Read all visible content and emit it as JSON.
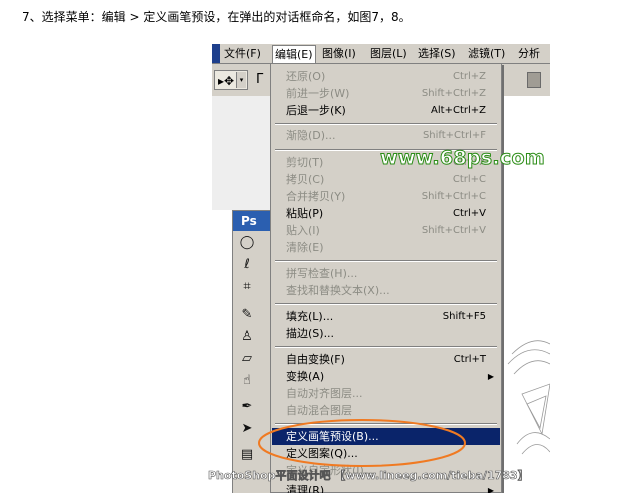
{
  "instruction": "7、选择菜单：编辑 > 定义画笔预设，在弹出的对话框命名，如图7，8。",
  "menubar": {
    "items": [
      {
        "label": "文件(F)"
      },
      {
        "label": "编辑(E)",
        "active": true
      },
      {
        "label": "图像(I)"
      },
      {
        "label": "图层(L)"
      },
      {
        "label": "选择(S)"
      },
      {
        "label": "滤镜(T)"
      },
      {
        "label": "分析"
      }
    ]
  },
  "options_bar": {
    "tool_glyph": "▸✥",
    "dropdown": "▾",
    "separator": "Γ"
  },
  "toolbox": {
    "logo": "Ps",
    "tools": [
      {
        "name": "ellipse-marquee",
        "glyph": "◯"
      },
      {
        "name": "lasso",
        "glyph": "ℓ"
      },
      {
        "name": "crop",
        "glyph": "⌗"
      },
      {
        "name": "healing-brush",
        "glyph": "✎"
      },
      {
        "name": "clone-stamp",
        "glyph": "♙"
      },
      {
        "name": "eraser",
        "glyph": "▱"
      },
      {
        "name": "smudge",
        "glyph": "☝"
      },
      {
        "name": "pen",
        "glyph": "✒"
      },
      {
        "name": "direct-select",
        "glyph": "➤"
      },
      {
        "name": "notes",
        "glyph": "▤"
      }
    ]
  },
  "edit_menu": {
    "items": [
      {
        "label": "还原(O)",
        "shortcut": "Ctrl+Z",
        "disabled": true
      },
      {
        "label": "前进一步(W)",
        "shortcut": "Shift+Ctrl+Z",
        "disabled": true
      },
      {
        "label": "后退一步(K)",
        "shortcut": "Alt+Ctrl+Z",
        "disabled": false
      },
      {
        "label": "渐隐(D)...",
        "shortcut": "Shift+Ctrl+F",
        "disabled": true
      },
      {
        "label": "剪切(T)",
        "shortcut": "Ctrl+X",
        "disabled": true
      },
      {
        "label": "拷贝(C)",
        "shortcut": "Ctrl+C",
        "disabled": true
      },
      {
        "label": "合并拷贝(Y)",
        "shortcut": "Shift+Ctrl+C",
        "disabled": true
      },
      {
        "label": "粘贴(P)",
        "shortcut": "Ctrl+V",
        "disabled": false
      },
      {
        "label": "贴入(I)",
        "shortcut": "Shift+Ctrl+V",
        "disabled": true
      },
      {
        "label": "清除(E)",
        "shortcut": "",
        "disabled": true
      },
      {
        "label": "拼写检查(H)...",
        "shortcut": "",
        "disabled": true
      },
      {
        "label": "查找和替换文本(X)...",
        "shortcut": "",
        "disabled": true
      },
      {
        "label": "填充(L)...",
        "shortcut": "Shift+F5",
        "disabled": false
      },
      {
        "label": "描边(S)...",
        "shortcut": "",
        "disabled": false
      },
      {
        "label": "自由变换(F)",
        "shortcut": "Ctrl+T",
        "disabled": false
      },
      {
        "label": "变换(A)",
        "shortcut": "",
        "disabled": false,
        "submenu": true
      },
      {
        "label": "自动对齐图层...",
        "shortcut": "",
        "disabled": true
      },
      {
        "label": "自动混合图层",
        "shortcut": "",
        "disabled": true
      },
      {
        "label": "定义画笔预设(B)...",
        "shortcut": "",
        "disabled": false,
        "highlighted": true
      },
      {
        "label": "定义图案(Q)...",
        "shortcut": "",
        "disabled": false
      },
      {
        "label": "定义自定形状(J)...",
        "shortcut": "",
        "disabled": true
      },
      {
        "label": "清理(R)",
        "shortcut": "",
        "disabled": false,
        "submenu": true
      }
    ],
    "submenu_arrow": "▶",
    "highlight_color": "#0a246a",
    "annotation_color": "#f07a22"
  },
  "watermarks": {
    "site": "www.68ps.com",
    "footer": "PhotoShop平面设计吧 【www.lineeg.com/tieba/1783】",
    "site_color": "#2c8d17"
  }
}
